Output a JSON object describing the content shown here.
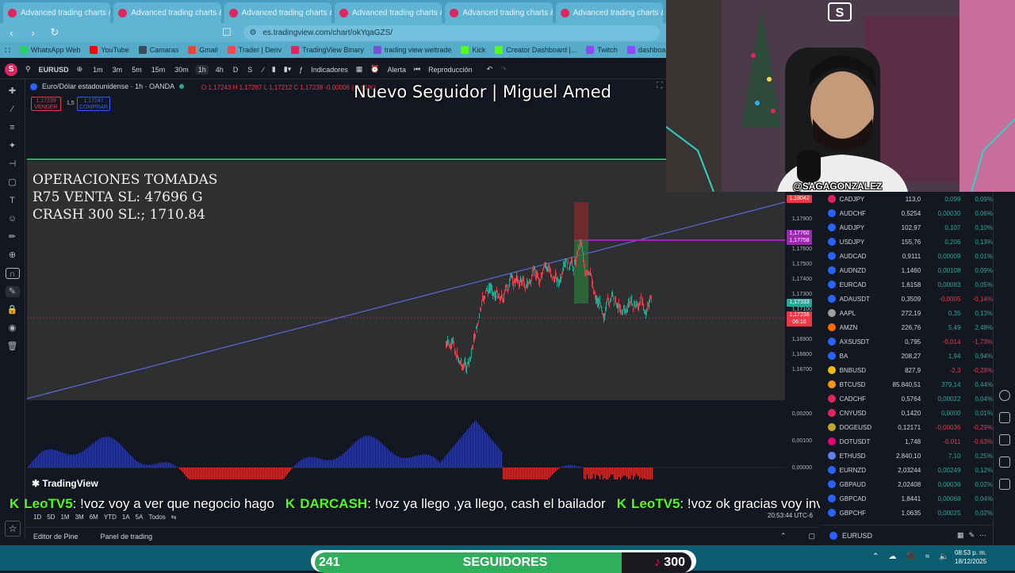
{
  "browser": {
    "tabs": [
      {
        "label": "Advanced trading charts & to"
      },
      {
        "label": "Advanced trading charts & to"
      },
      {
        "label": "Advanced trading charts & to"
      },
      {
        "label": "Advanced trading charts & to"
      },
      {
        "label": "Advanced trading charts & to"
      },
      {
        "label": "Advanced trading charts & to"
      }
    ],
    "url": "es.tradingview.com/chart/okYqaGZS/",
    "bookmarks": [
      {
        "label": "WhatsApp Web",
        "color": "#25d366"
      },
      {
        "label": "YouTube",
        "color": "#ff0000"
      },
      {
        "label": "Camaras",
        "color": "#3a4a5a"
      },
      {
        "label": "Gmail",
        "color": "#ea4335"
      },
      {
        "label": "Trader | Deriv",
        "color": "#ff444f"
      },
      {
        "label": "TradingView Binary",
        "color": "#e0245e"
      },
      {
        "label": "trading view weltrade",
        "color": "#7a4fd8"
      },
      {
        "label": "Kick",
        "color": "#53fc18"
      },
      {
        "label": "Creator Dashboard |...",
        "color": "#53fc18"
      },
      {
        "label": "Twitch",
        "color": "#9146ff"
      },
      {
        "label": "dashboard twitch",
        "color": "#9146ff"
      }
    ]
  },
  "toolbar": {
    "symbol": "EURUSD",
    "timeframes": [
      "1m",
      "3m",
      "5m",
      "15m",
      "30m",
      "1h",
      "4h",
      "D",
      "S"
    ],
    "active_timeframe": "1h",
    "indicators_label": "Indicadores",
    "alert_label": "Alerta",
    "replay_label": "Reproducción"
  },
  "chart": {
    "title": "Euro/Dólar estadounidense · 1h · OANDA",
    "ohlc": "O 1,17243 H 1,17287 L 1,17212 C 1,17238 -0,00006 (-0,01%)",
    "sell_price": "1,17239",
    "sell_label": "VENDER",
    "spread": "1,5",
    "buy_price": "1,17247",
    "buy_label": "COMPRAR",
    "price_ticks": [
      "1,17900",
      "1,17700",
      "1,17600",
      "1,17500",
      "1,17400",
      "1,17300",
      "1,17100",
      "1,17000",
      "1,16900",
      "1,16800",
      "1,16700"
    ],
    "price_tags": [
      {
        "label": "1,18042",
        "color": "#f23645"
      },
      {
        "label": "1,17760",
        "color": "#9c27b0"
      },
      {
        "label": "1,17758",
        "color": "#9c27b0"
      },
      {
        "label": "1,17333",
        "color": "#22ab94"
      },
      {
        "label": "1,17238",
        "color": "#f23645"
      },
      {
        "label": "06:16",
        "color": "#f23645"
      }
    ],
    "osc_ticks": [
      "0,00200",
      "0,00100",
      "0,00000"
    ],
    "ranges": [
      "1D",
      "5D",
      "1M",
      "3M",
      "6M",
      "YTD",
      "1A",
      "5A",
      "Todos"
    ],
    "clock": "20:53:44 UTC-6",
    "tv_brand": "TradingView"
  },
  "overlay": {
    "title": "Nuevo Seguidor | Miguel Amed",
    "operations": [
      "OPERACIONES TOMADAS",
      "R75 VENTA SL: 47696 G",
      "CRASH 300 SL:; 1710.84"
    ]
  },
  "ticker": [
    {
      "name": "LeoTV5",
      "text": ": !voz voy a ver que negocio hago"
    },
    {
      "name": "DARCASH",
      "text": ": !voz ya llego ,ya llego, cash el bailador"
    },
    {
      "name": "LeoTV5",
      "text": ": !voz ok gracias voy invertir solo un porcentaje s"
    }
  ],
  "bottom": {
    "pine_editor": "Editor de Pine",
    "trading_panel": "Panel de trading"
  },
  "follow_bar": {
    "current": "241",
    "label": "SEGUIDORES",
    "goal": "300"
  },
  "webcam": {
    "handle": "@SAGAGONZALEZ"
  },
  "watchlist": [
    {
      "symbol": "CADJPY",
      "last": "113,0",
      "change": "0,099",
      "pct": "0,09%",
      "dir": "pos",
      "color": "#e0245e"
    },
    {
      "symbol": "AUDCHF",
      "last": "0,5254",
      "change": "0,00030",
      "pct": "0,06%",
      "dir": "pos",
      "color": "#2962ff"
    },
    {
      "symbol": "AUDJPY",
      "last": "102,97",
      "change": "0,107",
      "pct": "0,10%",
      "dir": "pos",
      "color": "#2962ff"
    },
    {
      "symbol": "USDJPY",
      "last": "155,76",
      "change": "0,206",
      "pct": "0,13%",
      "dir": "pos",
      "color": "#2962ff"
    },
    {
      "symbol": "AUDCAD",
      "last": "0,9111",
      "change": "0,00009",
      "pct": "0,01%",
      "dir": "pos",
      "color": "#2962ff"
    },
    {
      "symbol": "AUDNZD",
      "last": "1,1460",
      "change": "0,00108",
      "pct": "0,09%",
      "dir": "pos",
      "color": "#2962ff"
    },
    {
      "symbol": "EURCAD",
      "last": "1,6158",
      "change": "0,00083",
      "pct": "0,05%",
      "dir": "pos",
      "color": "#2962ff"
    },
    {
      "symbol": "ADAUSDT",
      "last": "0,3509",
      "change": "-0,0005",
      "pct": "-0,14%",
      "dir": "neg",
      "color": "#2962ff"
    },
    {
      "symbol": "AAPL",
      "last": "272,19",
      "change": "0,35",
      "pct": "0,13%",
      "dir": "pos",
      "color": "#9e9e9e"
    },
    {
      "symbol": "AMZN",
      "last": "226,76",
      "change": "5,49",
      "pct": "2,48%",
      "dir": "pos",
      "color": "#ff6d00"
    },
    {
      "symbol": "AXSUSDT",
      "last": "0,795",
      "change": "-0,014",
      "pct": "-1,73%",
      "dir": "neg",
      "color": "#2962ff"
    },
    {
      "symbol": "BA",
      "last": "208,27",
      "change": "1,94",
      "pct": "0,94%",
      "dir": "pos",
      "color": "#2962ff"
    },
    {
      "symbol": "BNBUSD",
      "last": "827,9",
      "change": "-2,3",
      "pct": "-0,28%",
      "dir": "neg",
      "color": "#f0b90b"
    },
    {
      "symbol": "BTCUSD",
      "last": "85.840,51",
      "change": "379,14",
      "pct": "0,44%",
      "dir": "pos",
      "color": "#f7931a"
    },
    {
      "symbol": "CADCHF",
      "last": "0,5764",
      "change": "0,00022",
      "pct": "0,04%",
      "dir": "pos",
      "color": "#e0245e"
    },
    {
      "symbol": "CNYUSD",
      "last": "0,1420",
      "change": "0,0000",
      "pct": "0,01%",
      "dir": "pos",
      "color": "#e0245e"
    },
    {
      "symbol": "DOGEUSD",
      "last": "0,12171",
      "change": "-0,00036",
      "pct": "-0,29%",
      "dir": "neg",
      "color": "#c2a633"
    },
    {
      "symbol": "DOTUSDT",
      "last": "1,748",
      "change": "-0,011",
      "pct": "-0,63%",
      "dir": "neg",
      "color": "#e6007a"
    },
    {
      "symbol": "ETHUSD",
      "last": "2.840,10",
      "change": "7,10",
      "pct": "0,25%",
      "dir": "pos",
      "color": "#627eea"
    },
    {
      "symbol": "EURNZD",
      "last": "2,03244",
      "change": "0,00249",
      "pct": "0,12%",
      "dir": "pos",
      "color": "#2962ff"
    },
    {
      "symbol": "GBPAUD",
      "last": "2,02408",
      "change": "0,00036",
      "pct": "0,02%",
      "dir": "pos",
      "color": "#2962ff"
    },
    {
      "symbol": "GBPCAD",
      "last": "1,8441",
      "change": "0,00068",
      "pct": "0,04%",
      "dir": "pos",
      "color": "#2962ff"
    },
    {
      "symbol": "GBPCHF",
      "last": "1,0635",
      "change": "0,00025",
      "pct": "0,02%",
      "dir": "pos",
      "color": "#2962ff"
    }
  ],
  "watch_footer": {
    "symbol": "EURUSD"
  },
  "system": {
    "time": "08:53 p. m.",
    "date": "18/12/2025"
  }
}
